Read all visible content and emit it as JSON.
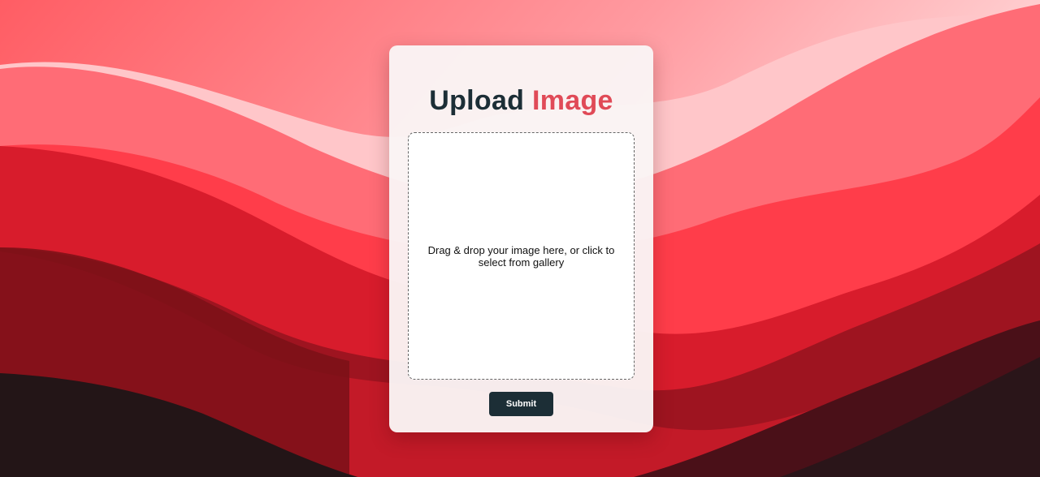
{
  "header": {
    "title_word1": "Upload",
    "title_word2": "Image"
  },
  "dropzone": {
    "text": "Drag & drop your image here, or click to select from gallery"
  },
  "actions": {
    "submit_label": "Submit"
  },
  "colors": {
    "title_dark": "#1c2e36",
    "title_accent": "#e04a57",
    "button_bg": "#1c2e36",
    "card_bg": "#faf5f5"
  }
}
